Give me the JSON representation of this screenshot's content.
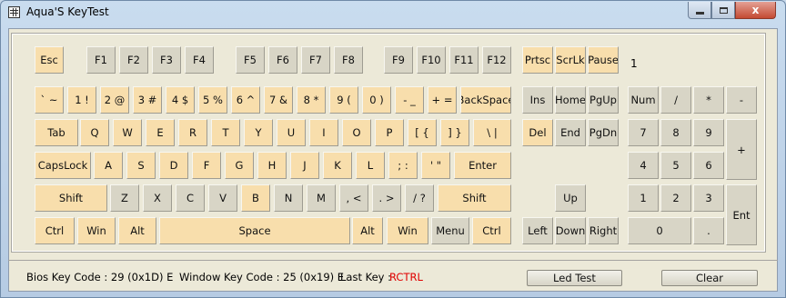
{
  "window": {
    "title": "Aqua'S KeyTest",
    "controls": {
      "close": "x"
    }
  },
  "indicator": "1",
  "keys": [
    {
      "label": "Esc",
      "name": "key-esc",
      "on": true
    },
    {
      "label": "F1",
      "name": "key-f1",
      "on": false
    },
    {
      "label": "F2",
      "name": "key-f2",
      "on": false
    },
    {
      "label": "F3",
      "name": "key-f3",
      "on": false
    },
    {
      "label": "F4",
      "name": "key-f4",
      "on": false
    },
    {
      "label": "F5",
      "name": "key-f5",
      "on": false
    },
    {
      "label": "F6",
      "name": "key-f6",
      "on": false
    },
    {
      "label": "F7",
      "name": "key-f7",
      "on": false
    },
    {
      "label": "F8",
      "name": "key-f8",
      "on": false
    },
    {
      "label": "F9",
      "name": "key-f9",
      "on": false
    },
    {
      "label": "F10",
      "name": "key-f10",
      "on": false
    },
    {
      "label": "F11",
      "name": "key-f11",
      "on": false
    },
    {
      "label": "F12",
      "name": "key-f12",
      "on": false
    },
    {
      "label": "Prtsc",
      "name": "key-prtsc",
      "on": true
    },
    {
      "label": "ScrLk",
      "name": "key-scrlk",
      "on": true
    },
    {
      "label": "Pause",
      "name": "key-pause",
      "on": true
    },
    {
      "label": "` ~",
      "name": "key-backtick",
      "on": true
    },
    {
      "label": "1 !",
      "name": "key-1",
      "on": true
    },
    {
      "label": "2 @",
      "name": "key-2",
      "on": true
    },
    {
      "label": "3 #",
      "name": "key-3",
      "on": true
    },
    {
      "label": "4 $",
      "name": "key-4",
      "on": true
    },
    {
      "label": "5 %",
      "name": "key-5",
      "on": true
    },
    {
      "label": "6 ^",
      "name": "key-6",
      "on": true
    },
    {
      "label": "7 &",
      "name": "key-7",
      "on": true
    },
    {
      "label": "8 *",
      "name": "key-8",
      "on": true
    },
    {
      "label": "9 (",
      "name": "key-9",
      "on": true
    },
    {
      "label": "0 )",
      "name": "key-0",
      "on": true
    },
    {
      "label": "- _",
      "name": "key-minus",
      "on": true
    },
    {
      "label": "+ =",
      "name": "key-equals",
      "on": true
    },
    {
      "label": "BackSpace",
      "name": "key-backspace",
      "on": true
    },
    {
      "label": "Ins",
      "name": "key-ins",
      "on": false
    },
    {
      "label": "Home",
      "name": "key-home",
      "on": false
    },
    {
      "label": "PgUp",
      "name": "key-pgup",
      "on": false
    },
    {
      "label": "Num",
      "name": "key-numlock",
      "on": false
    },
    {
      "label": "/",
      "name": "key-num-divide",
      "on": false
    },
    {
      "label": "*",
      "name": "key-num-multiply",
      "on": false
    },
    {
      "label": "-",
      "name": "key-num-minus",
      "on": false
    },
    {
      "label": "Tab",
      "name": "key-tab",
      "on": true
    },
    {
      "label": "Q",
      "name": "key-q",
      "on": true
    },
    {
      "label": "W",
      "name": "key-w",
      "on": true
    },
    {
      "label": "E",
      "name": "key-e",
      "on": true
    },
    {
      "label": "R",
      "name": "key-r",
      "on": true
    },
    {
      "label": "T",
      "name": "key-t",
      "on": true
    },
    {
      "label": "Y",
      "name": "key-y",
      "on": true
    },
    {
      "label": "U",
      "name": "key-u",
      "on": true
    },
    {
      "label": "I",
      "name": "key-i",
      "on": true
    },
    {
      "label": "O",
      "name": "key-o",
      "on": true
    },
    {
      "label": "P",
      "name": "key-p",
      "on": true
    },
    {
      "label": "[ {",
      "name": "key-lbracket",
      "on": true
    },
    {
      "label": "] }",
      "name": "key-rbracket",
      "on": true
    },
    {
      "label": "\\ |",
      "name": "key-backslash",
      "on": true
    },
    {
      "label": "Del",
      "name": "key-del",
      "on": true
    },
    {
      "label": "End",
      "name": "key-end",
      "on": false
    },
    {
      "label": "PgDn",
      "name": "key-pgdn",
      "on": false
    },
    {
      "label": "7",
      "name": "key-num-7",
      "on": false
    },
    {
      "label": "8",
      "name": "key-num-8",
      "on": false
    },
    {
      "label": "9",
      "name": "key-num-9",
      "on": false
    },
    {
      "label": "+",
      "name": "key-num-plus",
      "on": false
    },
    {
      "label": "CapsLock",
      "name": "key-capslock",
      "on": true
    },
    {
      "label": "A",
      "name": "key-a",
      "on": true
    },
    {
      "label": "S",
      "name": "key-s",
      "on": true
    },
    {
      "label": "D",
      "name": "key-d",
      "on": true
    },
    {
      "label": "F",
      "name": "key-f",
      "on": true
    },
    {
      "label": "G",
      "name": "key-g",
      "on": true
    },
    {
      "label": "H",
      "name": "key-h",
      "on": true
    },
    {
      "label": "J",
      "name": "key-j",
      "on": true
    },
    {
      "label": "K",
      "name": "key-k",
      "on": true
    },
    {
      "label": "L",
      "name": "key-l",
      "on": true
    },
    {
      "label": "; :",
      "name": "key-semicolon",
      "on": true
    },
    {
      "label": "' \"",
      "name": "key-quote",
      "on": true
    },
    {
      "label": "Enter",
      "name": "key-enter",
      "on": true
    },
    {
      "label": "4",
      "name": "key-num-4",
      "on": false
    },
    {
      "label": "5",
      "name": "key-num-5",
      "on": false
    },
    {
      "label": "6",
      "name": "key-num-6",
      "on": false
    },
    {
      "label": "Shift",
      "name": "key-lshift",
      "on": true
    },
    {
      "label": "Z",
      "name": "key-z",
      "on": false
    },
    {
      "label": "X",
      "name": "key-x",
      "on": false
    },
    {
      "label": "C",
      "name": "key-c",
      "on": false
    },
    {
      "label": "V",
      "name": "key-v",
      "on": false
    },
    {
      "label": "B",
      "name": "key-b",
      "on": true
    },
    {
      "label": "N",
      "name": "key-n",
      "on": false
    },
    {
      "label": "M",
      "name": "key-m",
      "on": false
    },
    {
      "label": ", <",
      "name": "key-comma",
      "on": false
    },
    {
      "label": ". >",
      "name": "key-period",
      "on": false
    },
    {
      "label": "/ ?",
      "name": "key-slash",
      "on": false
    },
    {
      "label": "Shift",
      "name": "key-rshift",
      "on": true
    },
    {
      "label": "Up",
      "name": "key-up",
      "on": false
    },
    {
      "label": "1",
      "name": "key-num-1",
      "on": false
    },
    {
      "label": "2",
      "name": "key-num-2",
      "on": false
    },
    {
      "label": "3",
      "name": "key-num-3",
      "on": false
    },
    {
      "label": "Ent",
      "name": "key-num-enter",
      "on": false
    },
    {
      "label": "Ctrl",
      "name": "key-lctrl",
      "on": true
    },
    {
      "label": "Win",
      "name": "key-lwin",
      "on": true
    },
    {
      "label": "Alt",
      "name": "key-lalt",
      "on": true
    },
    {
      "label": "Space",
      "name": "key-space",
      "on": true
    },
    {
      "label": "Alt",
      "name": "key-ralt",
      "on": true
    },
    {
      "label": "Win",
      "name": "key-rwin",
      "on": true
    },
    {
      "label": "Menu",
      "name": "key-menu",
      "on": false
    },
    {
      "label": "Ctrl",
      "name": "key-rctrl",
      "on": true
    },
    {
      "label": "Left",
      "name": "key-left",
      "on": false
    },
    {
      "label": "Down",
      "name": "key-down",
      "on": false
    },
    {
      "label": "Right",
      "name": "key-right",
      "on": false
    },
    {
      "label": "0",
      "name": "key-num-0",
      "on": false
    },
    {
      "label": ".",
      "name": "key-num-decimal",
      "on": false
    }
  ],
  "status": {
    "bios_label": "Bios Key Code : 29 (0x1D) E",
    "window_label": "Window Key Code : 25 (0x19) E",
    "last_key_label": "Last Key :",
    "last_key_value": "RCTRL",
    "last_key_color": "#e00000"
  },
  "buttons": {
    "led_test": "Led Test",
    "clear": "Clear"
  },
  "colors": {
    "key_active": "#f8deac",
    "key_idle": "#d8d5c6"
  }
}
